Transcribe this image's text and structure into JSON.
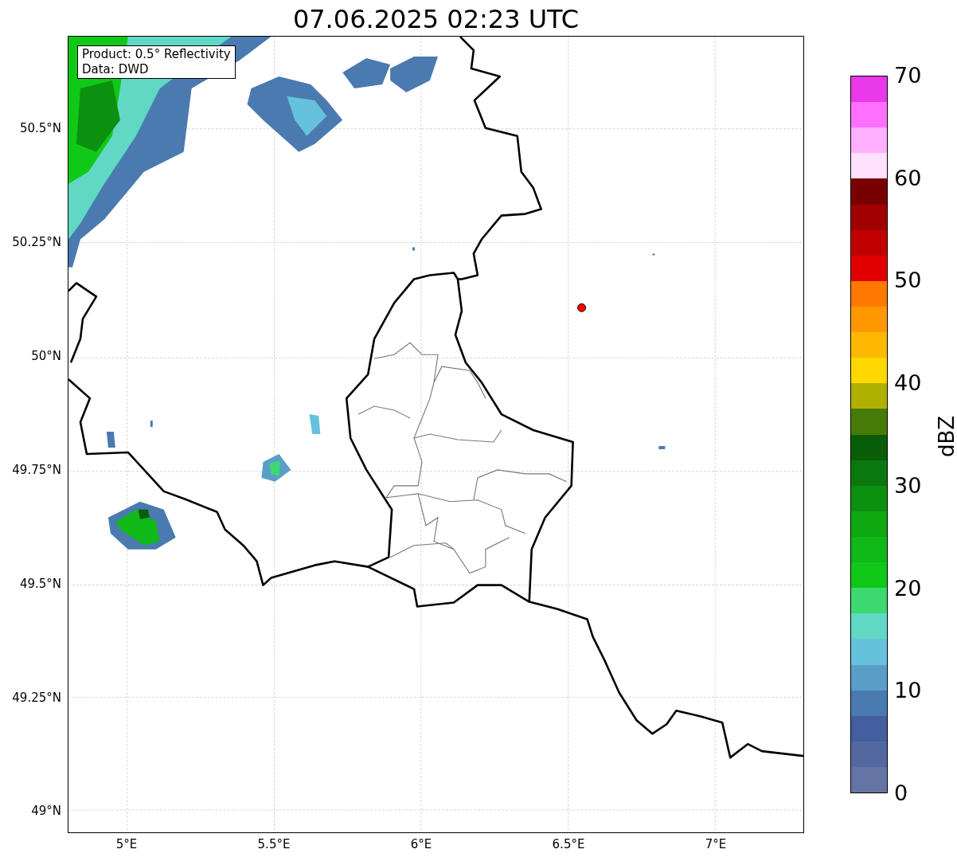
{
  "title": "07.06.2025 02:23 UTC",
  "annotation": [
    "Product: 0.5° Reflectivity",
    "Data: DWD"
  ],
  "yticks": [
    "50.5°N",
    "50.25°N",
    "50°N",
    "49.75°N",
    "49.5°N",
    "49.25°N",
    "49°N"
  ],
  "xticks": [
    "5°E",
    "5.5°E",
    "6°E",
    "6.5°E",
    "7°E"
  ],
  "colorbar": {
    "label": "dBZ",
    "ticks": [
      "70",
      "60",
      "50",
      "40",
      "30",
      "20",
      "10",
      "0"
    ],
    "bins": [
      {
        "color": "#e838e8"
      },
      {
        "color": "#ff70ff"
      },
      {
        "color": "#ffb0ff"
      },
      {
        "color": "#ffe0ff"
      },
      {
        "color": "#780000"
      },
      {
        "color": "#a00000"
      },
      {
        "color": "#c00000"
      },
      {
        "color": "#e00000"
      },
      {
        "color": "#ff7800"
      },
      {
        "color": "#ff9800"
      },
      {
        "color": "#ffb800"
      },
      {
        "color": "#ffd800"
      },
      {
        "color": "#b0b000"
      },
      {
        "color": "#487a08"
      },
      {
        "color": "#085e08"
      },
      {
        "color": "#0a780e"
      },
      {
        "color": "#0c9010"
      },
      {
        "color": "#10a810"
      },
      {
        "color": "#10b818"
      },
      {
        "color": "#10c818"
      },
      {
        "color": "#3cd870"
      },
      {
        "color": "#60d8c4"
      },
      {
        "color": "#66c2dc"
      },
      {
        "color": "#5a9ec8"
      },
      {
        "color": "#4a7ab0"
      },
      {
        "color": "#445fa0"
      },
      {
        "color": "#5468a0"
      },
      {
        "color": "#6474a4"
      }
    ]
  }
}
